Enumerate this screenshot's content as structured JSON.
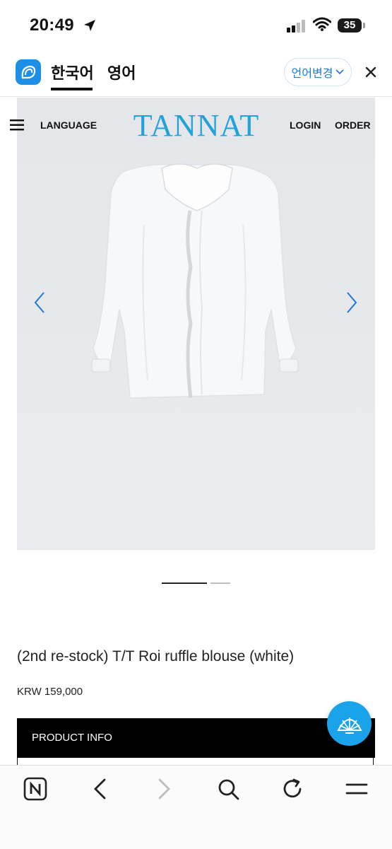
{
  "status_bar": {
    "time": "20:49",
    "battery": "35",
    "icons": [
      "location-arrow-icon",
      "signal-icon",
      "wifi-icon",
      "battery-icon"
    ]
  },
  "translate_bar": {
    "tabs": [
      "한국어",
      "영어"
    ],
    "active_tab": "한국어",
    "change_language_label": "언어변경",
    "icons": [
      "translator-app-icon",
      "chevron-down-icon",
      "close-icon"
    ]
  },
  "site_header": {
    "language_label": "LANGUAGE",
    "logo": "TANNAT",
    "login_label": "LOGIN",
    "order_label": "ORDER",
    "logo_color": "#1fa3d8"
  },
  "carousel": {
    "slide_count": 2,
    "active_slide": 1,
    "icons": [
      "chevron-left-icon",
      "chevron-right-icon"
    ],
    "arrow_color": "#1a7ad8"
  },
  "product": {
    "title": "(2nd re-stock) T/T Roi ruffle blouse (white)",
    "price": "KRW 159,000",
    "info_section_label": "PRODUCT INFO"
  },
  "fab": {
    "icon": "shell-icon",
    "color": "#1aa3e8"
  },
  "browser_toolbar": {
    "icons": [
      "naver-home-icon",
      "back-icon",
      "forward-icon",
      "search-icon",
      "reload-icon",
      "menu-icon"
    ]
  }
}
